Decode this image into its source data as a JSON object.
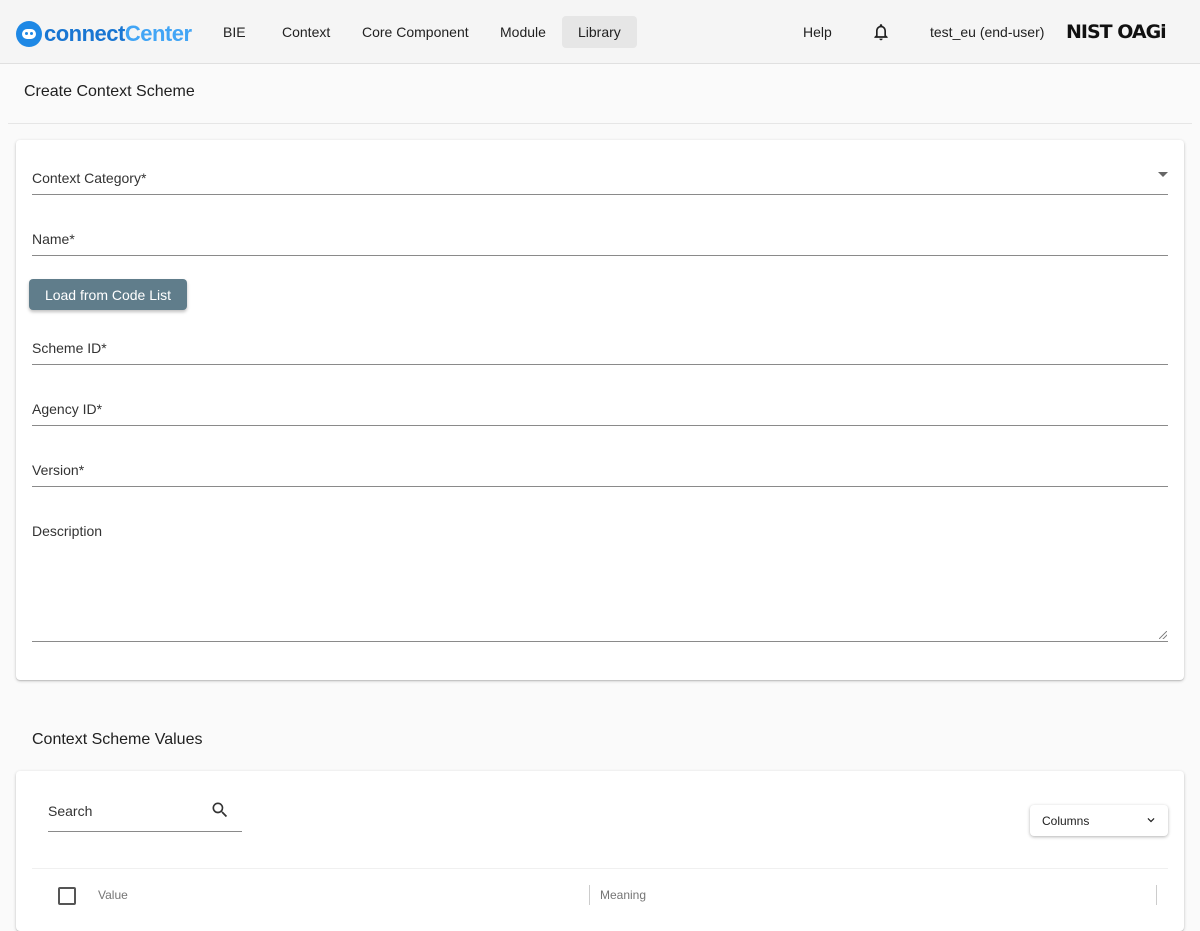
{
  "app": {
    "logo_part1": "connect",
    "logo_part2": "Center",
    "partner_logo": "NIST OAGi",
    "accent_color": "#1976d2",
    "button_color": "#607d8b"
  },
  "nav": {
    "items": [
      {
        "label": "BIE",
        "active": false
      },
      {
        "label": "Context",
        "active": false
      },
      {
        "label": "Core Component",
        "active": false
      },
      {
        "label": "Module",
        "active": false
      },
      {
        "label": "Library",
        "active": true
      }
    ],
    "help": "Help",
    "notifications_icon": "bell-icon",
    "user": "test_eu (end-user)"
  },
  "page": {
    "title": "Create Context Scheme"
  },
  "form": {
    "context_category": {
      "label": "Context Category*",
      "value": ""
    },
    "name": {
      "label": "Name*",
      "value": ""
    },
    "load_button": "Load from Code List",
    "scheme_id": {
      "label": "Scheme ID*",
      "value": ""
    },
    "agency_id": {
      "label": "Agency ID*",
      "value": ""
    },
    "version": {
      "label": "Version*",
      "value": ""
    },
    "description": {
      "label": "Description",
      "value": ""
    }
  },
  "values_section": {
    "title": "Context Scheme Values",
    "search_label": "Search",
    "columns_button": "Columns",
    "table": {
      "headers": [
        "Value",
        "Meaning"
      ],
      "rows": []
    }
  }
}
